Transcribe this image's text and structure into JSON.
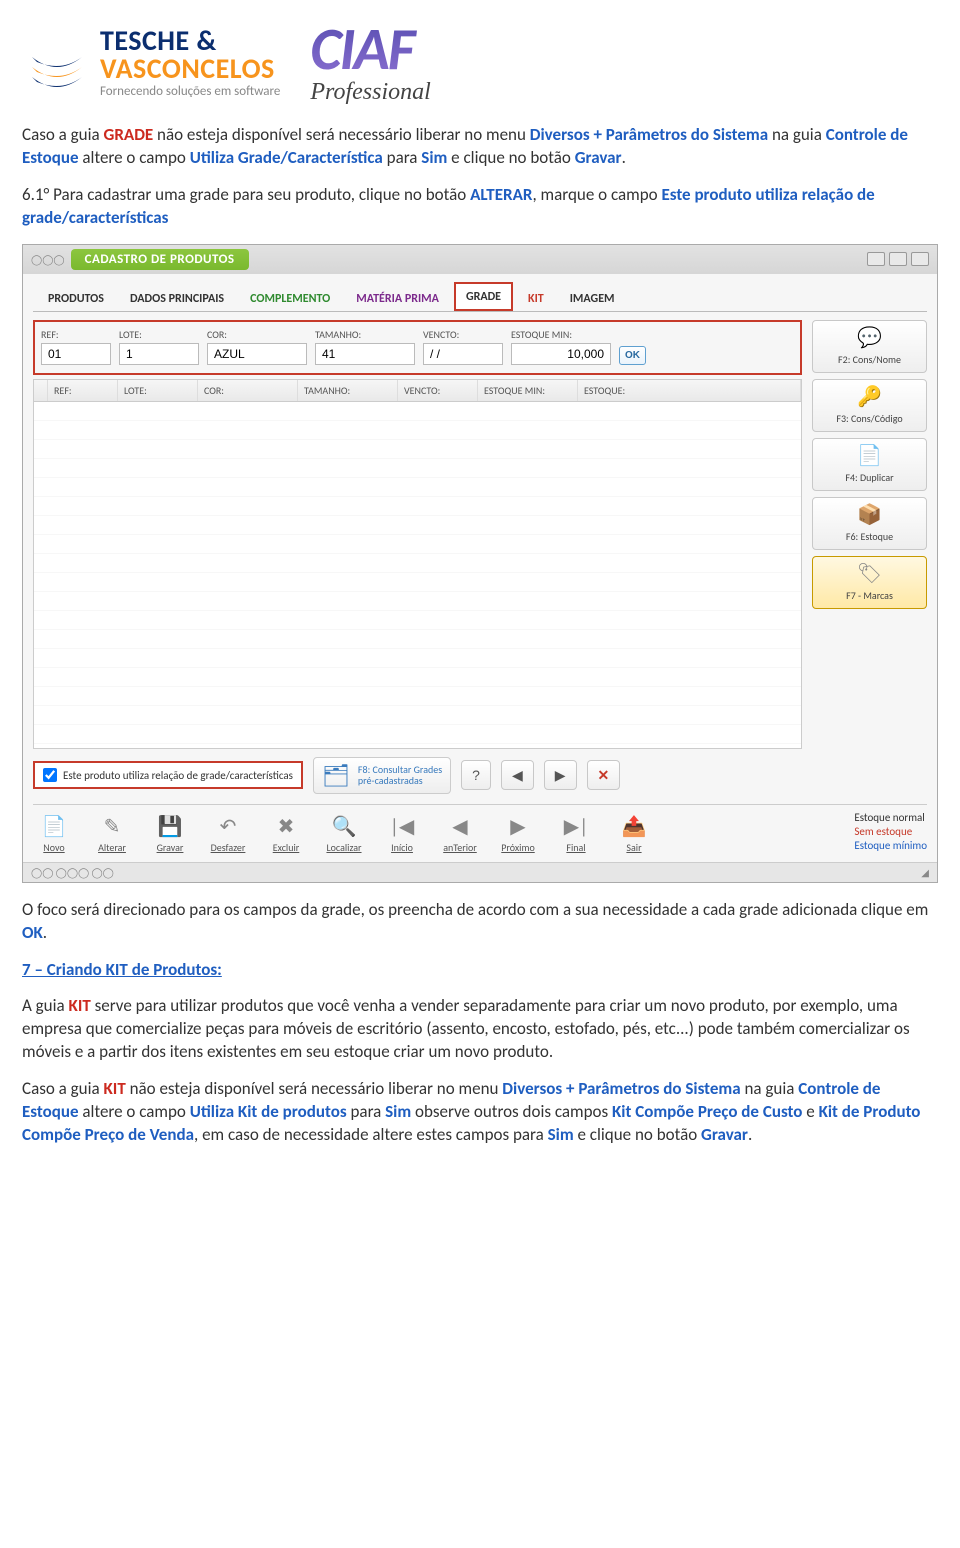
{
  "header": {
    "tv": {
      "l1": "TESCHE &",
      "l2": "VASCONCELOS",
      "tag": "Fornecendo soluções em software"
    },
    "ciaf": {
      "name": "CIAF",
      "tag": "Professional"
    }
  },
  "para1": {
    "seg1": "Caso a guia ",
    "grade": "GRADE",
    "seg2": " não esteja disponível será necessário liberar no menu ",
    "diversos": "Diversos + Parâmetros do Sistema",
    "seg3": " na guia ",
    "controle": "Controle de Estoque",
    "seg4": " altere o campo ",
    "utiliza": "Utiliza Grade/Característica",
    "seg5": " para ",
    "sim": "Sim",
    "seg6": " e clique no botão ",
    "gravar": "Gravar",
    "dot": "."
  },
  "para2": {
    "seg1": "6.1° Para cadastrar uma grade para seu produto, clique no botão ",
    "alterar": "ALTERAR",
    "seg2": ", marque o campo ",
    "campo": "Este produto utiliza relação de grade/características"
  },
  "app": {
    "title": "CADASTRO DE PRODUTOS",
    "corner": "00  ",
    "tabs": [
      {
        "label": "PRODUTOS",
        "color": "",
        "active": false
      },
      {
        "label": "DADOS PRINCIPAIS",
        "color": "",
        "active": false
      },
      {
        "label": "COMPLEMENTO",
        "color": "green",
        "active": false
      },
      {
        "label": "MATÉRIA PRIMA",
        "color": "purple",
        "active": false
      },
      {
        "label": "GRADE",
        "color": "red",
        "active": true
      },
      {
        "label": "KIT",
        "color": "red",
        "active": false
      },
      {
        "label": "IMAGEM",
        "color": "",
        "active": false
      }
    ],
    "fields": {
      "ref": {
        "label": "REF:",
        "value": "01"
      },
      "lote": {
        "label": "LOTE:",
        "value": "1"
      },
      "cor": {
        "label": "COR:",
        "value": "AZUL"
      },
      "tamanho": {
        "label": "TAMANHO:",
        "value": "41"
      },
      "vencto": {
        "label": "VENCTO:",
        "value": "/ /"
      },
      "estoquemin": {
        "label": "ESTOQUE MIN:",
        "value": "10,000"
      },
      "ok": "OK"
    },
    "grid_cols": [
      "REF:",
      "LOTE:",
      "COR:",
      "TAMANHO:",
      "VENCTO:",
      "ESTOQUE MIN:",
      "ESTOQUE:"
    ],
    "side": [
      {
        "label": "F2: Cons/Nome",
        "icon": "💬"
      },
      {
        "label": "F3: Cons/Código",
        "icon": "🔑"
      },
      {
        "label": "F4: Duplicar",
        "icon": "📄"
      },
      {
        "label": "F6: Estoque",
        "icon": "📦"
      },
      {
        "label": "F7 - Marcas",
        "icon": "🏷",
        "active": true
      }
    ],
    "checkbox_label": "Este produto utiliza relação de grade/características",
    "f8": {
      "l1": "F8: Consultar Grades",
      "l2": "pré-cadastradas"
    },
    "help": "?",
    "tools": [
      {
        "label": "Novo",
        "icon": "📄"
      },
      {
        "label": "Alterar",
        "icon": "✎"
      },
      {
        "label": "Gravar",
        "icon": "💾"
      },
      {
        "label": "Desfazer",
        "icon": "↶"
      },
      {
        "label": "Excluir",
        "icon": "✖"
      },
      {
        "label": "Localizar",
        "icon": "🔍"
      },
      {
        "label": "Início",
        "icon": "|◀"
      },
      {
        "label": "anTerior",
        "icon": "◀"
      },
      {
        "label": "Próximo",
        "icon": "▶"
      },
      {
        "label": "Final",
        "icon": "▶|"
      },
      {
        "label": "Sair",
        "icon": "📤"
      }
    ],
    "legend": {
      "l1": "Estoque normal",
      "l2": "Sem estoque",
      "l3": "Estoque mínimo"
    }
  },
  "para3": {
    "seg1": "O foco será direcionado para os campos da grade, os preencha de acordo com a sua necessidade a cada grade adicionada clique em ",
    "ok": "OK",
    "dot": "."
  },
  "section7": "7 – Criando KIT de Produtos:",
  "para4": {
    "seg1": "A guia ",
    "kit": "KIT",
    "seg2": " serve para utilizar produtos que você venha a vender separadamente para criar um novo produto, por exemplo, uma empresa que comercialize peças para móveis de escritório (assento, encosto, estofado, pés, etc...) pode também comercializar os móveis e a partir dos itens existentes em seu estoque criar um novo produto."
  },
  "para5": {
    "seg1": "Caso a guia ",
    "kit": "KIT",
    "seg2": " não esteja disponível será necessário liberar no menu ",
    "diversos": "Diversos + Parâmetros do Sistema",
    "seg3": " na guia ",
    "controle": "Controle de Estoque",
    "seg4": " altere o campo ",
    "utiliza": "Utiliza Kit de produtos",
    "seg5": " para ",
    "sim": "Sim",
    "seg6": " observe outros dois campos ",
    "kcusto": "Kit Compõe Preço de Custo",
    "seg7": " e ",
    "kvenda": "Kit de Produto Compõe Preço de Venda",
    "seg8": ", em caso de necessidade altere estes campos para ",
    "sim2": "Sim",
    "seg9": " e clique no botão ",
    "gravar": "Gravar",
    "dot": "."
  }
}
